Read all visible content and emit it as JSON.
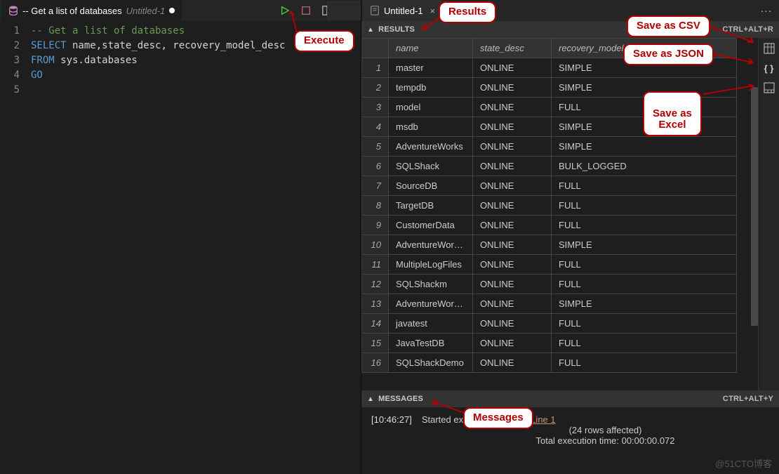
{
  "editor": {
    "tab_icon": "database-icon",
    "tab_title": "-- Get a list of databases",
    "tab_subtitle": "Untitled-1",
    "tab_dirty": true,
    "lines": [
      {
        "n": "1",
        "tokens": [
          {
            "cls": "tk-comment",
            "t": "-- Get a list of databases"
          }
        ]
      },
      {
        "n": "2",
        "tokens": [
          {
            "cls": "tk-keyword",
            "t": "SELECT"
          },
          {
            "cls": "tk-ident",
            "t": " name,state_desc, recovery_model_desc"
          }
        ]
      },
      {
        "n": "3",
        "tokens": [
          {
            "cls": "tk-keyword",
            "t": "FROM"
          },
          {
            "cls": "tk-ident",
            "t": " sys.databases"
          }
        ]
      },
      {
        "n": "4",
        "tokens": [
          {
            "cls": "tk-go",
            "t": "GO"
          }
        ]
      },
      {
        "n": "5",
        "tokens": []
      }
    ]
  },
  "right_tab": {
    "title": "Untitled-1"
  },
  "sections": {
    "results_label": "RESULTS",
    "results_shortcut": "CTRL+ALT+R",
    "messages_label": "MESSAGES",
    "messages_shortcut": "CTRL+ALT+Y"
  },
  "grid": {
    "columns": [
      "",
      "name",
      "state_desc",
      "recovery_model_desc"
    ],
    "rows": [
      {
        "n": "1",
        "name": "master",
        "state": "ONLINE",
        "rec": "SIMPLE"
      },
      {
        "n": "2",
        "name": "tempdb",
        "state": "ONLINE",
        "rec": "SIMPLE"
      },
      {
        "n": "3",
        "name": "model",
        "state": "ONLINE",
        "rec": "FULL"
      },
      {
        "n": "4",
        "name": "msdb",
        "state": "ONLINE",
        "rec": "SIMPLE"
      },
      {
        "n": "5",
        "name": "AdventureWorks",
        "state": "ONLINE",
        "rec": "SIMPLE"
      },
      {
        "n": "6",
        "name": "SQLShack",
        "state": "ONLINE",
        "rec": "BULK_LOGGED"
      },
      {
        "n": "7",
        "name": "SourceDB",
        "state": "ONLINE",
        "rec": "FULL"
      },
      {
        "n": "8",
        "name": "TargetDB",
        "state": "ONLINE",
        "rec": "FULL"
      },
      {
        "n": "9",
        "name": "CustomerData",
        "state": "ONLINE",
        "rec": "FULL"
      },
      {
        "n": "10",
        "name": "AdventureWork...",
        "state": "ONLINE",
        "rec": "SIMPLE"
      },
      {
        "n": "11",
        "name": "MultipleLogFiles",
        "state": "ONLINE",
        "rec": "FULL"
      },
      {
        "n": "12",
        "name": "SQLShackm",
        "state": "ONLINE",
        "rec": "FULL"
      },
      {
        "n": "13",
        "name": "AdventureWork...",
        "state": "ONLINE",
        "rec": "SIMPLE"
      },
      {
        "n": "14",
        "name": "javatest",
        "state": "ONLINE",
        "rec": "FULL"
      },
      {
        "n": "15",
        "name": "JavaTestDB",
        "state": "ONLINE",
        "rec": "FULL"
      },
      {
        "n": "16",
        "name": "SQLShackDemo",
        "state": "ONLINE",
        "rec": "FULL"
      }
    ]
  },
  "messages": {
    "timestamp": "[10:46:27]",
    "line1_prefix": "Started executing query at ",
    "line1_link": "Line 1",
    "line2": "(24 rows affected)",
    "line3": "Total execution time: 00:00:00.072"
  },
  "callouts": {
    "execute": "Execute",
    "results": "Results",
    "save_csv": "Save as CSV",
    "save_json": "Save as JSON",
    "save_excel": "Save as\nExcel",
    "messages": "Messages"
  },
  "watermark": "@51CTO博客"
}
